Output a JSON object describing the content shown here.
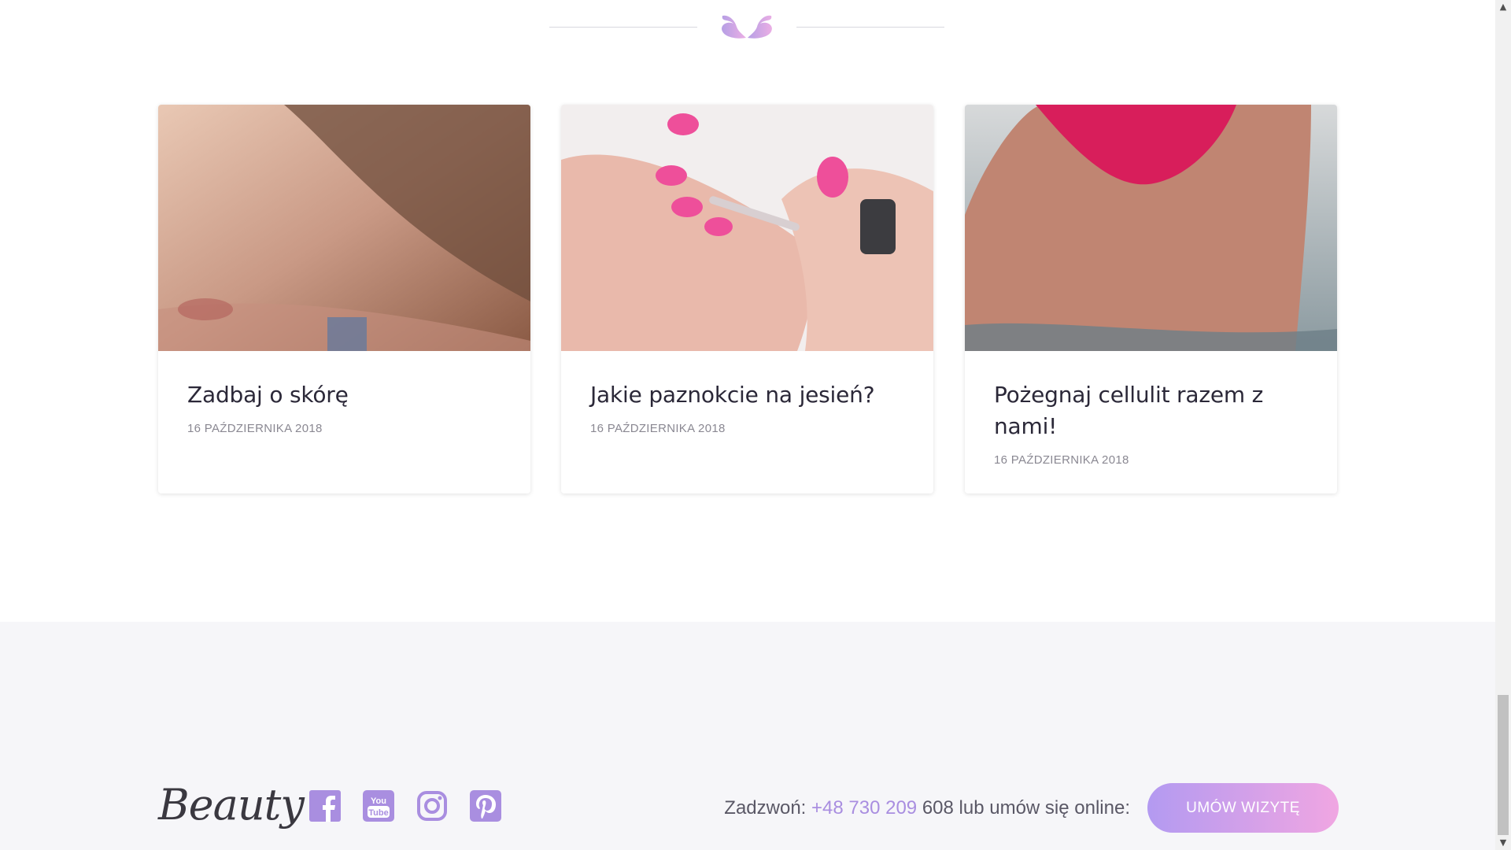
{
  "posts": [
    {
      "title": "Zadbaj o skórę",
      "date": "16 PAŹDZIERNIKA 2018",
      "image": "woman-skin-photo"
    },
    {
      "title": "Jakie paznokcie na jesień?",
      "date": "16 PAŹDZIERNIKA 2018",
      "image": "pink-nails-photo"
    },
    {
      "title": "Pożegnaj cellulit razem z nami!",
      "date": "16 PAŹDZIERNIKA 2018",
      "image": "bikini-water-photo"
    }
  ],
  "footer": {
    "logo": "Beauty",
    "socials": [
      "facebook-icon",
      "youtube-icon",
      "instagram-icon",
      "pinterest-icon"
    ],
    "contact_prefix": "Zadzwoń: ",
    "phone": "+48 730 209",
    "contact_suffix": " 608 lub umów się online:",
    "cta_label": "UMÓW WIZYTĘ"
  },
  "colors": {
    "accent": "#a98ee0",
    "cta_start": "#b39af1",
    "cta_end": "#f0a6e2",
    "footer_bg": "#f6f6f9",
    "title": "#2b2838"
  }
}
